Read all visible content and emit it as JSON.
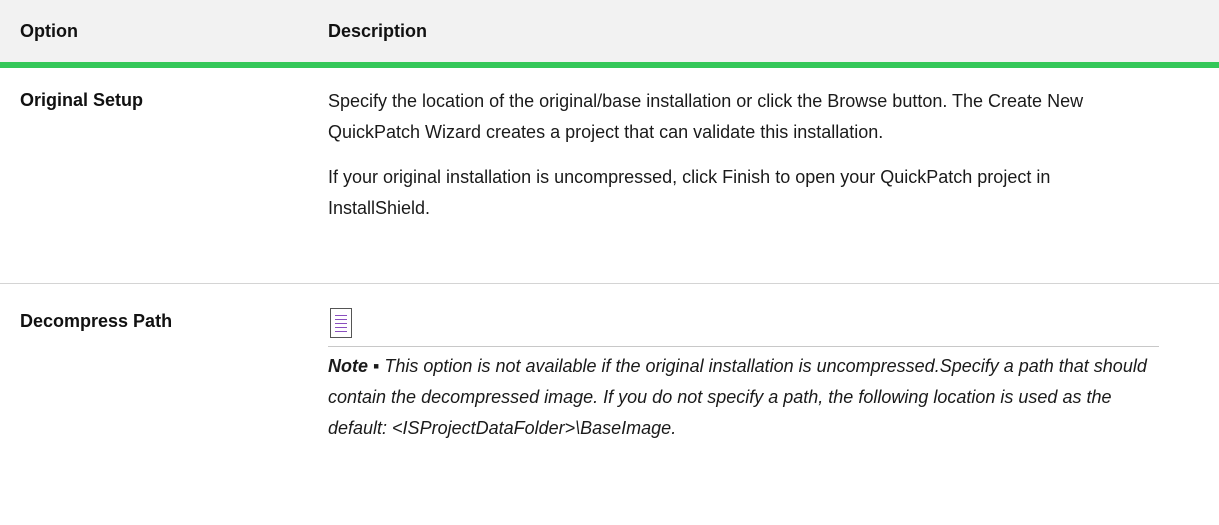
{
  "header": {
    "col_option": "Option",
    "col_description": "Description"
  },
  "rows": [
    {
      "option": "Original Setup",
      "paragraphs": [
        "Specify the location of the original/base installation or click the Browse button. The Create New QuickPatch Wizard creates a project that can validate this installation.",
        "If your original installation is uncompressed, click Finish to open your QuickPatch project in InstallShield."
      ]
    },
    {
      "option": "Decompress Path",
      "note_icon": "note-icon",
      "note_label": "Note ▪",
      "note_text": " This option is not available if the original installation is uncompressed.Specify a path that should contain the decompressed image. If you do not specify a path, the following location is used as the default: <ISProjectDataFolder>\\BaseImage."
    }
  ],
  "colors": {
    "header_bg": "#f2f2f2",
    "accent": "#34c759"
  }
}
